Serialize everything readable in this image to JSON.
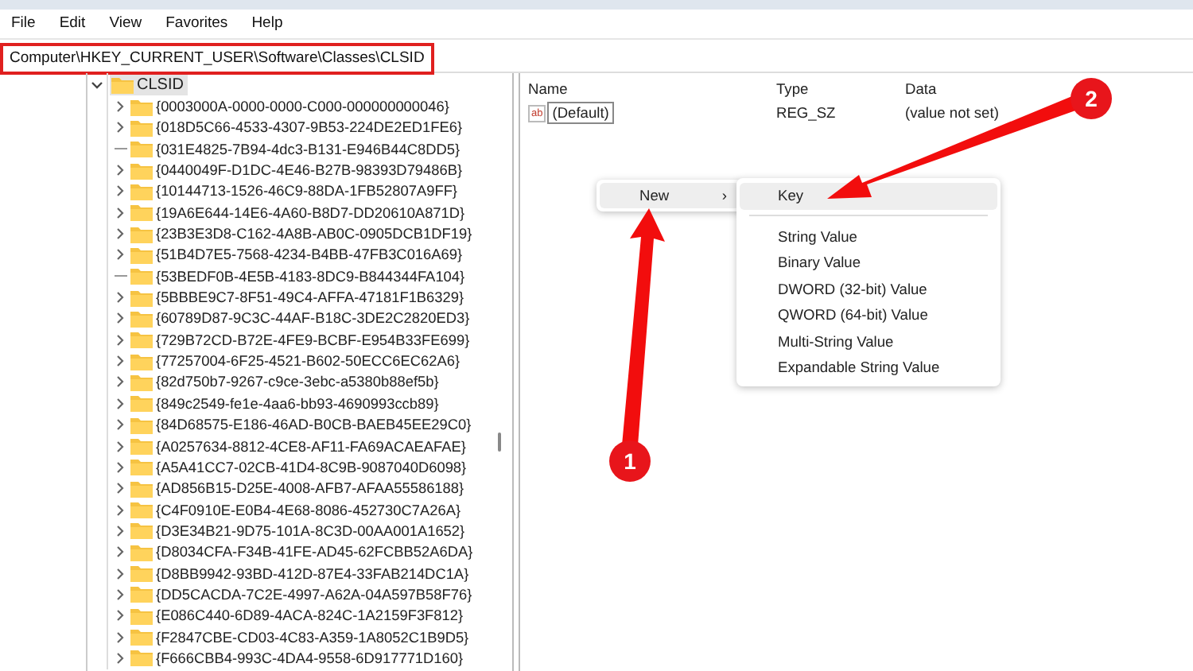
{
  "menu_bar": [
    {
      "label": "File"
    },
    {
      "label": "Edit"
    },
    {
      "label": "View"
    },
    {
      "label": "Favorites"
    },
    {
      "label": "Help"
    }
  ],
  "address_bar": {
    "value": "Computer\\HKEY_CURRENT_USER\\Software\\Classes\\CLSID",
    "highlighted": true
  },
  "tree": [
    {
      "label": "CLSID",
      "expanded": true,
      "selected": true,
      "children": [
        {
          "label": "{0003000A-0000-0000-C000-000000000046}",
          "has_children": true,
          "selected": false
        },
        {
          "label": "{018D5C66-4533-4307-9B53-224DE2ED1FE6}",
          "has_children": true,
          "selected": false
        },
        {
          "label": "{031E4825-7B94-4dc3-B131-E946B44C8DD5}",
          "has_children": false,
          "selected": false
        },
        {
          "label": "{0440049F-D1DC-4E46-B27B-98393D79486B}",
          "has_children": true,
          "selected": false
        },
        {
          "label": "{10144713-1526-46C9-88DA-1FB52807A9FF}",
          "has_children": true,
          "selected": false
        },
        {
          "label": "{19A6E644-14E6-4A60-B8D7-DD20610A871D}",
          "has_children": true,
          "selected": false
        },
        {
          "label": "{23B3E3D8-C162-4A8B-AB0C-0905DCB1DF19}",
          "has_children": true,
          "selected": false
        },
        {
          "label": "{51B4D7E5-7568-4234-B4BB-47FB3C016A69}",
          "has_children": true,
          "selected": false
        },
        {
          "label": "{53BEDF0B-4E5B-4183-8DC9-B844344FA104}",
          "has_children": false,
          "selected": false
        },
        {
          "label": "{5BBBE9C7-8F51-49C4-AFFA-47181F1B6329}",
          "has_children": true,
          "selected": false
        },
        {
          "label": "{60789D87-9C3C-44AF-B18C-3DE2C2820ED3}",
          "has_children": true,
          "selected": false
        },
        {
          "label": "{729B72CD-B72E-4FE9-BCBF-E954B33FE699}",
          "has_children": true,
          "selected": false
        },
        {
          "label": "{77257004-6F25-4521-B602-50ECC6EC62A6}",
          "has_children": true,
          "selected": false
        },
        {
          "label": "{82d750b7-9267-c9ce-3ebc-a5380b88ef5b}",
          "has_children": true,
          "selected": false
        },
        {
          "label": "{849c2549-fe1e-4aa6-bb93-4690993ccb89}",
          "has_children": true,
          "selected": false
        },
        {
          "label": "{84D68575-E186-46AD-B0CB-BAEB45EE29C0}",
          "has_children": true,
          "selected": false
        },
        {
          "label": "{A0257634-8812-4CE8-AF11-FA69ACAEAFAE}",
          "has_children": true,
          "selected": false
        },
        {
          "label": "{A5A41CC7-02CB-41D4-8C9B-9087040D6098}",
          "has_children": true,
          "selected": false
        },
        {
          "label": "{AD856B15-D25E-4008-AFB7-AFAA55586188}",
          "has_children": true,
          "selected": false
        },
        {
          "label": "{C4F0910E-E0B4-4E68-8086-452730C7A26A}",
          "has_children": true,
          "selected": false
        },
        {
          "label": "{D3E34B21-9D75-101A-8C3D-00AA001A1652}",
          "has_children": true,
          "selected": false
        },
        {
          "label": "{D8034CFA-F34B-41FE-AD45-62FCBB52A6DA}",
          "has_children": true,
          "selected": false
        },
        {
          "label": "{D8BB9942-93BD-412D-87E4-33FAB214DC1A}",
          "has_children": true,
          "selected": false
        },
        {
          "label": "{DD5CACDA-7C2E-4997-A62A-04A597B58F76}",
          "has_children": true,
          "selected": false
        },
        {
          "label": "{E086C440-6D89-4ACA-824C-1A2159F3F812}",
          "has_children": true,
          "selected": false
        },
        {
          "label": "{F2847CBE-CD03-4C83-A359-1A8052C1B9D5}",
          "has_children": true,
          "selected": false
        },
        {
          "label": "{F666CBB4-993C-4DA4-9558-6D917771D160}",
          "has_children": true,
          "selected": false
        }
      ]
    }
  ],
  "values_list": {
    "columns": [
      {
        "label": "Name"
      },
      {
        "label": "Type"
      },
      {
        "label": "Data"
      }
    ],
    "rows": [
      {
        "icon_text": "ab",
        "name": "(Default)",
        "type": "REG_SZ",
        "data": "(value not set)",
        "editing": true
      }
    ]
  },
  "context_menu": {
    "items": [
      {
        "label": "New",
        "selected": true,
        "submenu_arrow": "›"
      }
    ]
  },
  "submenu": {
    "items": [
      {
        "kind": "item",
        "label": "Key",
        "selected": true
      },
      {
        "kind": "separator"
      },
      {
        "kind": "item",
        "label": "String Value",
        "selected": false
      },
      {
        "kind": "item",
        "label": "Binary Value",
        "selected": false
      },
      {
        "kind": "item",
        "label": "DWORD (32-bit) Value",
        "selected": false
      },
      {
        "kind": "item",
        "label": "QWORD (64-bit) Value",
        "selected": false
      },
      {
        "kind": "item",
        "label": "Multi-String Value",
        "selected": false
      },
      {
        "kind": "item",
        "label": "Expandable String Value",
        "selected": false
      }
    ]
  },
  "annotations": [
    {
      "label": "1"
    },
    {
      "label": "2"
    }
  ]
}
